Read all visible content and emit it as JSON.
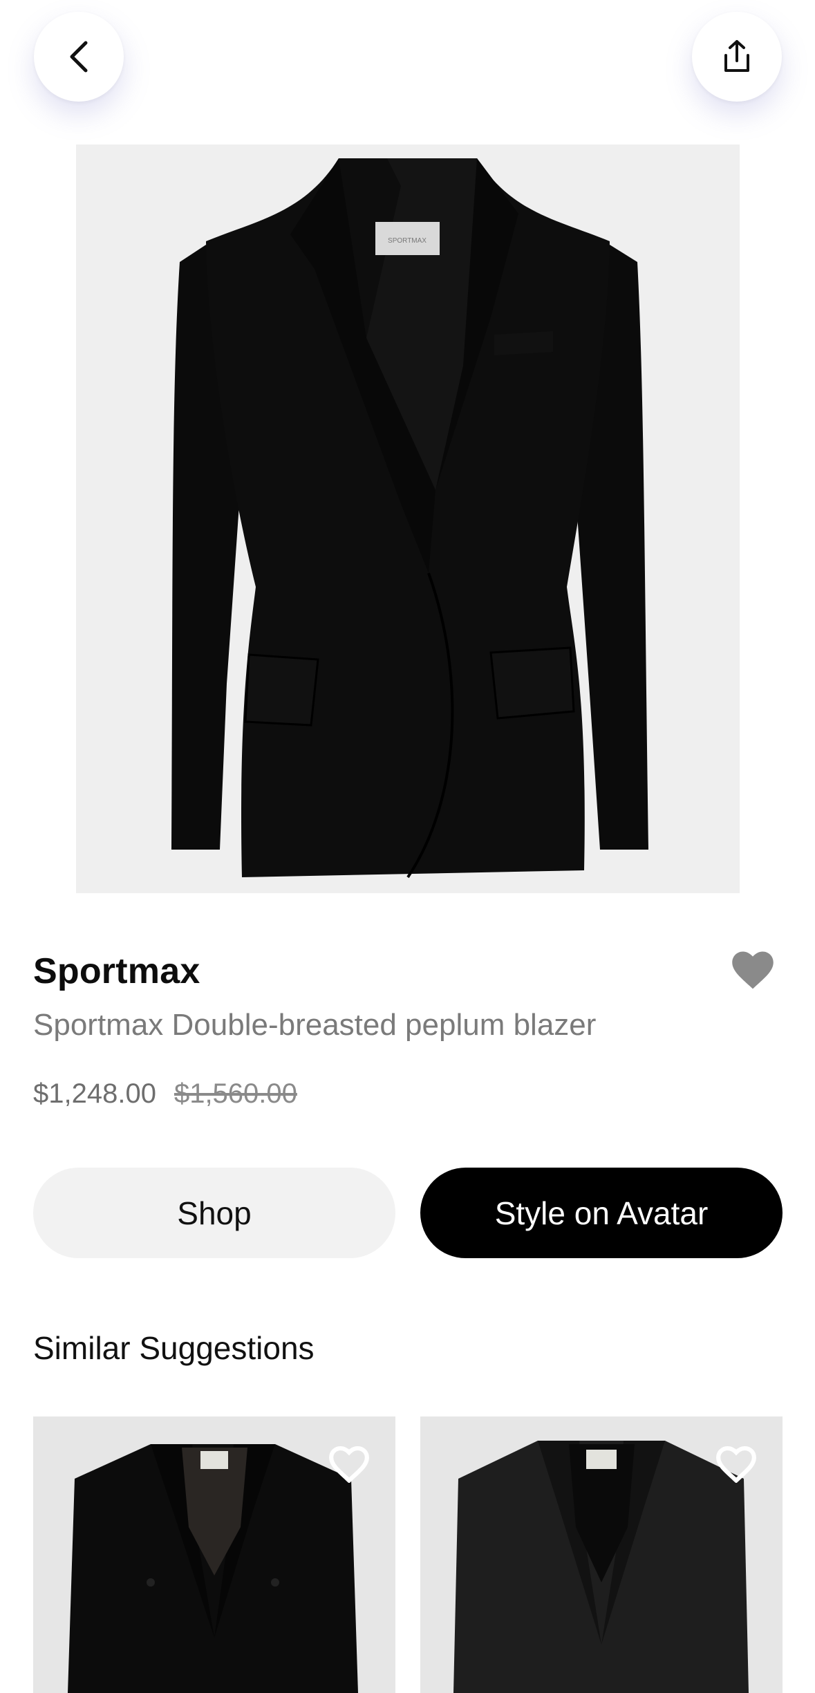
{
  "header": {
    "back_icon": "chevron-left-icon",
    "share_icon": "share-icon"
  },
  "product": {
    "brand": "Sportmax",
    "name": "Sportmax Double-breasted peplum blazer",
    "price": "$1,248.00",
    "original_price": "$1,560.00",
    "favorited": true,
    "image": "black-blazer-product-photo",
    "label_text": "SPORTMAX"
  },
  "actions": {
    "shop_label": "Shop",
    "style_label": "Style on Avatar"
  },
  "similar": {
    "title": "Similar Suggestions",
    "items": [
      {
        "image": "black-double-breasted-blazer",
        "favorited": false
      },
      {
        "image": "charcoal-blazer",
        "favorited": false
      }
    ]
  },
  "colors": {
    "heart_filled": "#8a8a8a",
    "primary_button": "#000000",
    "secondary_button": "#f2f2f2",
    "muted_text": "#7a7a7a"
  }
}
